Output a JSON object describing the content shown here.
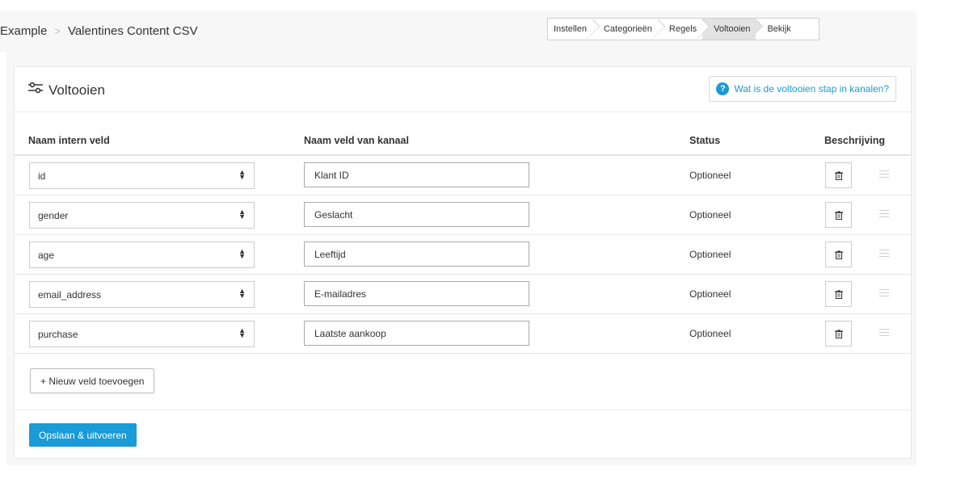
{
  "breadcrumb": {
    "root": "Example",
    "current": "Valentines Content CSV"
  },
  "wizard": {
    "steps": [
      "Instellen",
      "Categorieën",
      "Regels",
      "Voltooien",
      "Bekijk"
    ],
    "active": "Voltooien"
  },
  "panel": {
    "title": "Voltooien",
    "help_label": "Wat is de voltooien stap in kanalen?"
  },
  "table": {
    "headers": {
      "internal": "Naam intern veld",
      "channel": "Naam veld van kanaal",
      "status": "Status",
      "description": "Beschrijving"
    },
    "rows": [
      {
        "internal": "id",
        "channel": "Klant ID",
        "status": "Optioneel"
      },
      {
        "internal": "gender",
        "channel": "Geslacht",
        "status": "Optioneel"
      },
      {
        "internal": "age",
        "channel": "Leeftijd",
        "status": "Optioneel"
      },
      {
        "internal": "email_address",
        "channel": "E-mailadres",
        "status": "Optioneel"
      },
      {
        "internal": "purchase",
        "channel": "Laatste aankoop",
        "status": "Optioneel"
      }
    ]
  },
  "actions": {
    "add_field": "+ Nieuw veld toevoegen",
    "save": "Opslaan & uitvoeren"
  },
  "colors": {
    "accent": "#1a9ad6",
    "active_step": "#e3e3e3"
  },
  "icons": {
    "title": "sliders-icon",
    "help": "question-circle-icon",
    "row_delete": "trash-icon",
    "row_drag": "drag-handle-icon",
    "select_caret": "sort-caret-icon"
  }
}
